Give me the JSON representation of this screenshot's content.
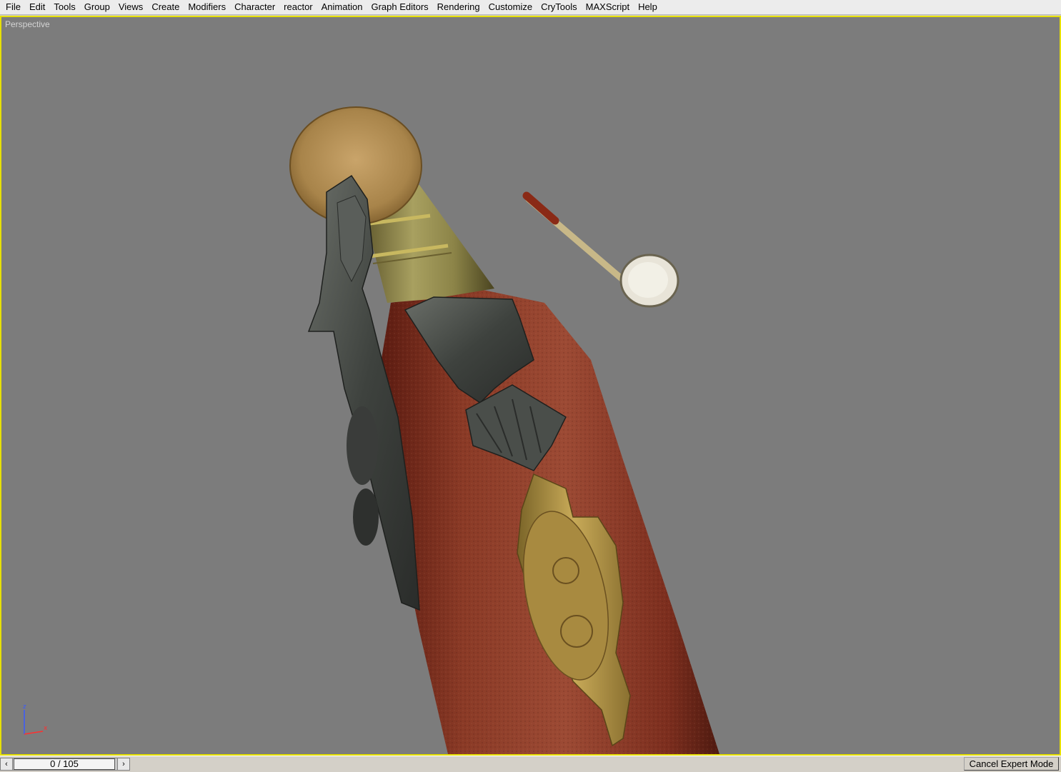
{
  "menu": [
    "File",
    "Edit",
    "Tools",
    "Group",
    "Views",
    "Create",
    "Modifiers",
    "Character",
    "reactor",
    "Animation",
    "Graph Editors",
    "Rendering",
    "Customize",
    "CryTools",
    "MAXScript",
    "Help"
  ],
  "viewport": {
    "label": "Perspective",
    "border_color": "#e6e000",
    "background_color": "#7c7c7c"
  },
  "scene": {
    "objects": [
      "flintlock-pistol-model",
      "ramrod-model"
    ]
  },
  "axis": {
    "z_label": "z",
    "x_label": "x"
  },
  "time_slider": {
    "value": "0 / 105",
    "prev_icon": "chevron-left-icon",
    "next_icon": "chevron-right-icon"
  },
  "status": {
    "cancel_expert_mode": "Cancel Expert Mode"
  }
}
